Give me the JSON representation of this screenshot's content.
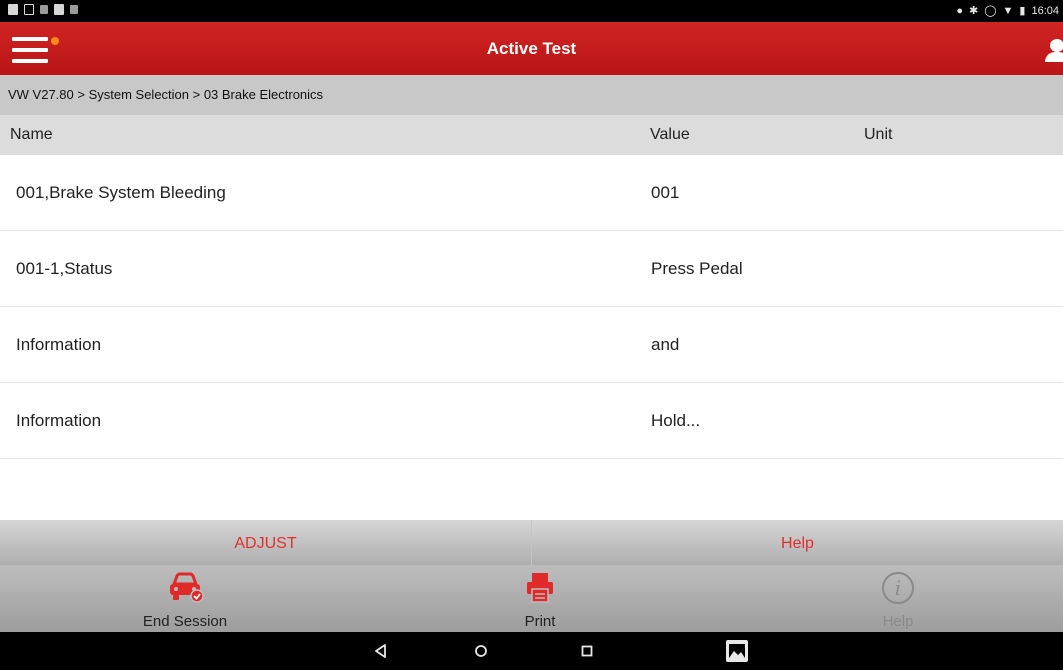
{
  "status_bar": {
    "time": "16:04",
    "left_icons": [
      "image-icon",
      "screen-icon",
      "usb-icon",
      "image-icon",
      "scan-icon"
    ],
    "right_icons": [
      "location-icon",
      "bluetooth-icon",
      "alarm-icon",
      "wifi-icon",
      "battery-icon"
    ]
  },
  "header": {
    "title": "Active Test",
    "menu_icon": "hamburger-menu-icon",
    "user_icon": "user-icon",
    "notify_color": "#ff8c1a"
  },
  "breadcrumb": "VW V27.80 > System Selection > 03 Brake Electronics",
  "table": {
    "columns": [
      "Name",
      "Value",
      "Unit"
    ],
    "rows": [
      {
        "name": "001,Brake System Bleeding",
        "value": "001",
        "unit": ""
      },
      {
        "name": "001-1,Status",
        "value": "Press Pedal",
        "unit": ""
      },
      {
        "name": "Information",
        "value": "and",
        "unit": ""
      },
      {
        "name": "Information",
        "value": "Hold...",
        "unit": ""
      }
    ]
  },
  "actions": {
    "adjust": "ADJUST",
    "help": "Help"
  },
  "toolbar": {
    "end_session": "End Session",
    "print": "Print",
    "help": "Help"
  },
  "nav": {
    "buttons": [
      "back-icon",
      "home-icon",
      "recents-icon",
      "screenshot-icon"
    ]
  },
  "colors": {
    "header_red": "#c81e1e",
    "action_text": "#e23030",
    "breadcrumb_bg": "#c8c8c8"
  }
}
